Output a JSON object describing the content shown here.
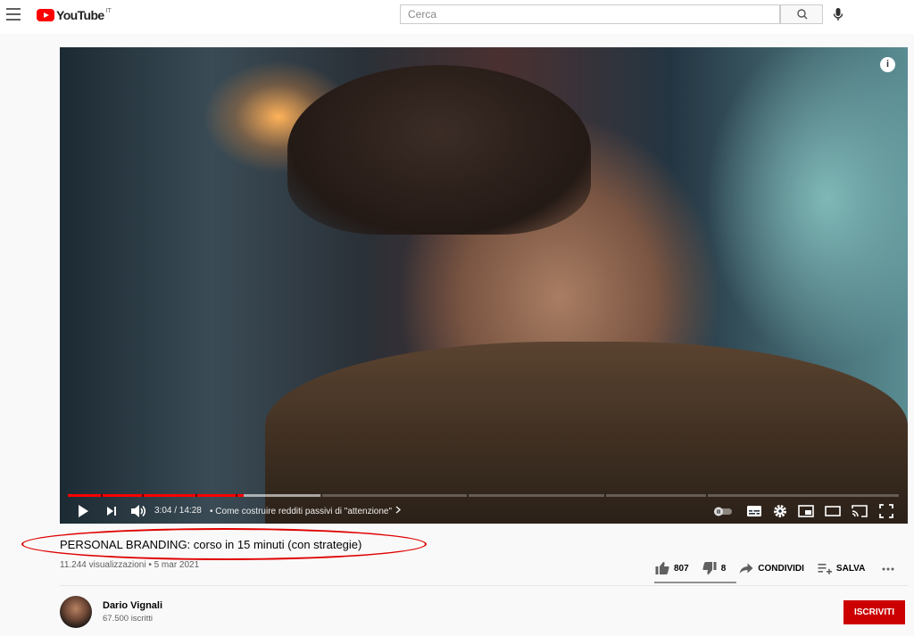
{
  "header": {
    "logo_text": "YouTube",
    "logo_country": "IT",
    "search_placeholder": "Cerca"
  },
  "player": {
    "current_time": "3:04",
    "duration": "14:28",
    "time_display": "3:04 / 14:28",
    "chapter_separator": "•",
    "chapter_title": "Come costruire redditi passivi di \"attenzione\"",
    "played_fraction": 0.212,
    "buffered_fraction": 0.305,
    "info_symbol": "i"
  },
  "video": {
    "title": "PERSONAL BRANDING: corso in 15 minuti (con strategie)",
    "views": "11.244 visualizzazioni",
    "separator": "•",
    "date": "5 mar 2021",
    "meta_line": "11.244 visualizzazioni • 5 mar 2021"
  },
  "actions": {
    "likes": "807",
    "dislikes": "8",
    "share_label": "CONDIVIDI",
    "save_label": "SALVA"
  },
  "channel": {
    "name": "Dario Vignali",
    "subscribers": "67.500 iscritti",
    "subscribe_label": "ISCRIVITI"
  },
  "colors": {
    "brand_red": "#ff0000",
    "subscribe_red": "#cc0000",
    "annotation_red": "#e00000",
    "background": "#f9f9f9"
  },
  "icons": {
    "menu": "hamburger-menu-icon",
    "search": "search-icon",
    "mic": "microphone-icon",
    "info": "info-icon",
    "play": "play-icon",
    "next": "next-icon",
    "volume": "volume-icon",
    "autoplay": "autoplay-toggle-icon",
    "subtitles": "subtitles-icon",
    "settings": "gear-icon",
    "miniplayer": "miniplayer-icon",
    "theater": "theater-mode-icon",
    "cast": "cast-icon",
    "fullscreen": "fullscreen-icon",
    "like": "thumbs-up-icon",
    "dislike": "thumbs-down-icon",
    "share": "share-icon",
    "save": "playlist-add-icon",
    "more": "more-horizontal-icon"
  }
}
